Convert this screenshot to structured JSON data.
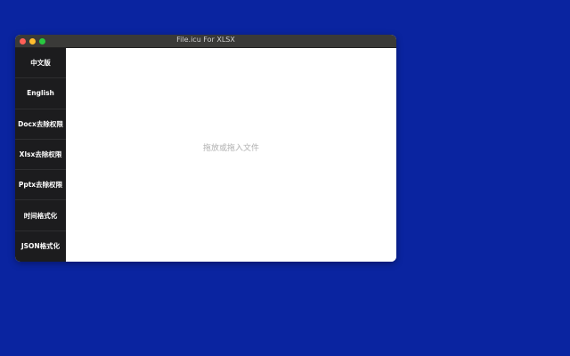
{
  "window": {
    "title": "File.icu For XLSX"
  },
  "sidebar": {
    "items": [
      {
        "label": "中文版"
      },
      {
        "label": "English"
      },
      {
        "label": "Docx去除权限"
      },
      {
        "label": "Xlsx去除权限"
      },
      {
        "label": "Pptx去除权限"
      },
      {
        "label": "时间格式化"
      },
      {
        "label": "JSON格式化"
      }
    ]
  },
  "main": {
    "drop_hint": "拖放或拖入文件"
  },
  "colors": {
    "desktop_background": "#0a24a0",
    "sidebar_background": "#1c1c1e",
    "titlebar_background": "#3a3a38"
  }
}
